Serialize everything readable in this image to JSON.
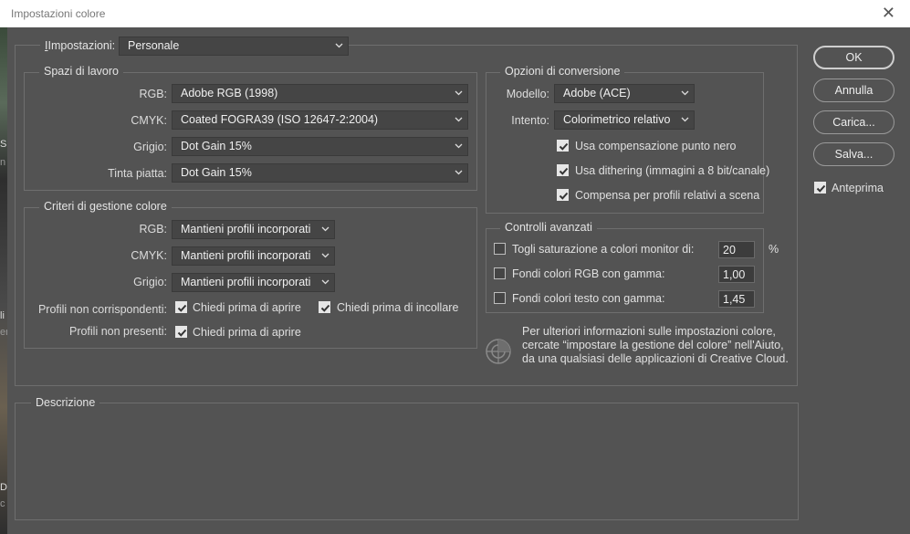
{
  "window": {
    "title": "Impostazioni colore",
    "close_symbol": "✕"
  },
  "background": {
    "text1": "S",
    "text2": "n",
    "text3": "li",
    "text4": "er",
    "text5": "D",
    "text6": "c"
  },
  "settings": {
    "label": "Impostazioni:",
    "value": "Personale"
  },
  "working_spaces": {
    "legend": "Spazi di lavoro",
    "rgb": {
      "label": "RGB:",
      "value": "Adobe RGB (1998)"
    },
    "cmyk": {
      "label": "CMYK:",
      "value": "Coated FOGRA39 (ISO 12647-2:2004)"
    },
    "gray": {
      "label": "Grigio:",
      "value": "Dot Gain 15%"
    },
    "spot": {
      "label": "Tinta piatta:",
      "value": "Dot Gain 15%"
    }
  },
  "policies": {
    "legend": "Criteri di gestione colore",
    "rgb": {
      "label": "RGB:",
      "value": "Mantieni profili incorporati"
    },
    "cmyk": {
      "label": "CMYK:",
      "value": "Mantieni profili incorporati"
    },
    "gray": {
      "label": "Grigio:",
      "value": "Mantieni profili incorporati"
    },
    "mismatch_label": "Profili non corrispondenti:",
    "ask_open": "Chiedi prima di aprire",
    "ask_paste": "Chiedi prima di incollare",
    "missing_label": "Profili non presenti:",
    "missing_ask_open": "Chiedi prima di aprire"
  },
  "conversion": {
    "legend": "Opzioni di conversione",
    "engine": {
      "label": "Modello:",
      "value": "Adobe (ACE)"
    },
    "intent": {
      "label": "Intento:",
      "value": "Colorimetrico relativo"
    },
    "black_point": "Usa compensazione punto nero",
    "dither": "Usa dithering (immagini a 8 bit/canale)",
    "scene": "Compensa per profili relativi a scena"
  },
  "advanced": {
    "legend": "Controlli avanzati",
    "desaturate": {
      "label": "Togli saturazione a colori monitor di:",
      "value": "20",
      "unit": "%"
    },
    "blend_rgb": {
      "label": "Fondi colori RGB con gamma:",
      "value": "1,00"
    },
    "blend_text": {
      "label": "Fondi colori testo con gamma:",
      "value": "1,45"
    }
  },
  "info": {
    "line1": "Per ulteriori informazioni sulle impostazioni colore,",
    "line2": "cercate “impostare la gestione del colore” nell'Aiuto,",
    "line3": "da una qualsiasi delle applicazioni di Creative Cloud."
  },
  "description": {
    "legend": "Descrizione"
  },
  "buttons": {
    "ok": "OK",
    "cancel": "Annulla",
    "load": "Carica...",
    "save": "Salva..."
  },
  "preview": {
    "label": "Anteprima",
    "checked": true
  }
}
